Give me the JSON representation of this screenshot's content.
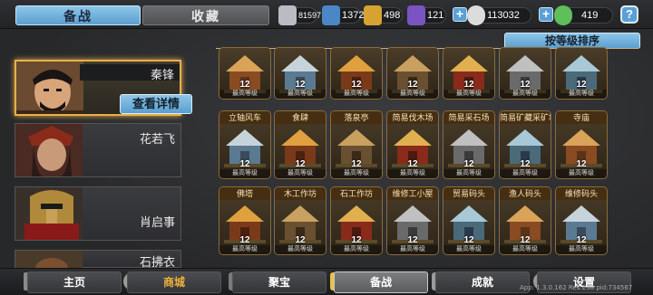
{
  "tabs": {
    "active": "备战",
    "inactive": "收藏"
  },
  "resources": {
    "r1": "81597",
    "r2": "1372",
    "r3": "498",
    "r4": "121",
    "coins": "113032",
    "gems": "419"
  },
  "help_label": "?",
  "plus_label": "+",
  "sort_label": "按等级排序",
  "heroes": [
    {
      "name": "秦锋",
      "detail_label": "查看详情"
    },
    {
      "name": "花若飞"
    },
    {
      "name": "肖启事"
    },
    {
      "name": "石拂衣"
    }
  ],
  "buildings_row1": [
    {
      "level": "12",
      "sub": "最高等级"
    },
    {
      "level": "12",
      "sub": "最高等级"
    },
    {
      "level": "12",
      "sub": "最高等级"
    },
    {
      "level": "12",
      "sub": "最高等级"
    },
    {
      "level": "12",
      "sub": "最高等级"
    },
    {
      "level": "12",
      "sub": "最高等级"
    },
    {
      "level": "12",
      "sub": "最高等级"
    }
  ],
  "buildings_row2": [
    {
      "title": "立轴风车",
      "level": "12",
      "sub": "最高等级"
    },
    {
      "title": "食肆",
      "level": "12",
      "sub": "最高等级"
    },
    {
      "title": "落泉亭",
      "level": "12",
      "sub": "最高等级"
    },
    {
      "title": "简易伐木场",
      "level": "12",
      "sub": "最高等级"
    },
    {
      "title": "简易采石场",
      "level": "12",
      "sub": "最高等级"
    },
    {
      "title": "简易矿藏采矿场",
      "level": "12",
      "sub": "最高等级"
    },
    {
      "title": "寺庙",
      "level": "12",
      "sub": "最高等级"
    }
  ],
  "buildings_row3": [
    {
      "title": "佛塔",
      "level": "12",
      "sub": "最高等级"
    },
    {
      "title": "木工作坊",
      "level": "12",
      "sub": "最高等级"
    },
    {
      "title": "石工作坊",
      "level": "12",
      "sub": "最高等级"
    },
    {
      "title": "维修工小屋",
      "level": "12",
      "sub": "最高等级"
    },
    {
      "title": "贸易码头",
      "level": "12",
      "sub": "最高等级"
    },
    {
      "title": "渔人码头",
      "level": "12",
      "sub": "最高等级"
    },
    {
      "title": "维修码头",
      "level": "12",
      "sub": "最高等级"
    }
  ],
  "nav": [
    {
      "label": "主页"
    },
    {
      "label": "商城"
    },
    {
      "label": "聚宝"
    },
    {
      "label": "备战"
    },
    {
      "label": "成就"
    },
    {
      "label": "设置"
    }
  ],
  "version": "App: 1.3.0.162 Res:238 pid:734567",
  "colors": {
    "accent": "#5b9ed0",
    "gold": "#e7b04a",
    "shop": "#f0b23c"
  }
}
